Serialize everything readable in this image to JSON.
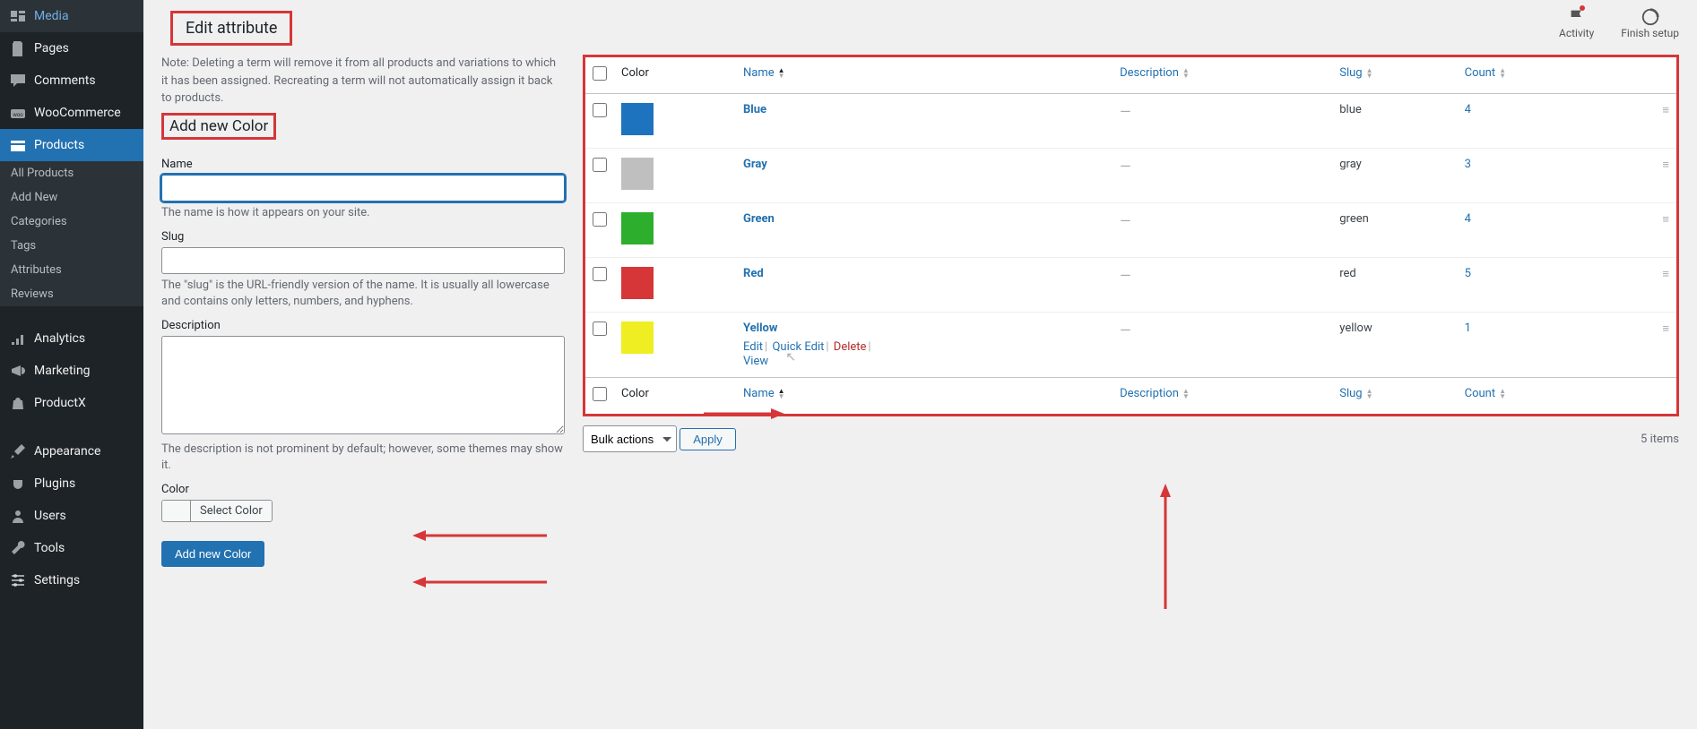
{
  "sidebar": {
    "top_items": [
      {
        "id": "media",
        "label": "Media"
      },
      {
        "id": "pages",
        "label": "Pages"
      },
      {
        "id": "comments",
        "label": "Comments"
      },
      {
        "id": "woocommerce",
        "label": "WooCommerce"
      },
      {
        "id": "products",
        "label": "Products"
      }
    ],
    "submenu": [
      {
        "id": "all-products",
        "label": "All Products"
      },
      {
        "id": "add-new",
        "label": "Add New"
      },
      {
        "id": "categories",
        "label": "Categories"
      },
      {
        "id": "tags",
        "label": "Tags"
      },
      {
        "id": "attributes",
        "label": "Attributes"
      },
      {
        "id": "reviews",
        "label": "Reviews"
      }
    ],
    "bottom_items": [
      {
        "id": "analytics",
        "label": "Analytics"
      },
      {
        "id": "marketing",
        "label": "Marketing"
      },
      {
        "id": "productx",
        "label": "ProductX"
      },
      {
        "id": "appearance",
        "label": "Appearance"
      },
      {
        "id": "plugins",
        "label": "Plugins"
      },
      {
        "id": "users",
        "label": "Users"
      },
      {
        "id": "tools",
        "label": "Tools"
      },
      {
        "id": "settings",
        "label": "Settings"
      }
    ]
  },
  "topbar": {
    "activity": "Activity",
    "finish_setup": "Finish setup"
  },
  "page": {
    "title": "Edit attribute",
    "note": "Note: Deleting a term will remove it from all products and variations to which it has been assigned. Recreating a term will not automatically assign it back to products.",
    "add_heading": "Add new Color",
    "name_label": "Name",
    "name_help": "The name is how it appears on your site.",
    "slug_label": "Slug",
    "slug_help": "The \"slug\" is the URL-friendly version of the name. It is usually all lowercase and contains only letters, numbers, and hyphens.",
    "desc_label": "Description",
    "desc_help": "The description is not prominent by default; however, some themes may show it.",
    "color_label": "Color",
    "select_color": "Select Color",
    "add_button": "Add new Color"
  },
  "table": {
    "col_color": "Color",
    "col_name": "Name",
    "col_desc": "Description",
    "col_slug": "Slug",
    "col_count": "Count",
    "rows": [
      {
        "hex": "#1e73be",
        "name": "Blue",
        "desc": "—",
        "slug": "blue",
        "count": "4"
      },
      {
        "hex": "#bfbfbf",
        "name": "Gray",
        "desc": "—",
        "slug": "gray",
        "count": "3"
      },
      {
        "hex": "#2daf2d",
        "name": "Green",
        "desc": "—",
        "slug": "green",
        "count": "4"
      },
      {
        "hex": "#d63638",
        "name": "Red",
        "desc": "—",
        "slug": "red",
        "count": "5"
      },
      {
        "hex": "#eeee22",
        "name": "Yellow",
        "desc": "—",
        "slug": "yellow",
        "count": "1"
      }
    ],
    "row_actions": {
      "edit": "Edit",
      "quick_edit": "Quick Edit",
      "delete": "Delete",
      "view": "View"
    }
  },
  "tablenav": {
    "bulk": "Bulk actions",
    "apply": "Apply",
    "items": "5 items"
  }
}
